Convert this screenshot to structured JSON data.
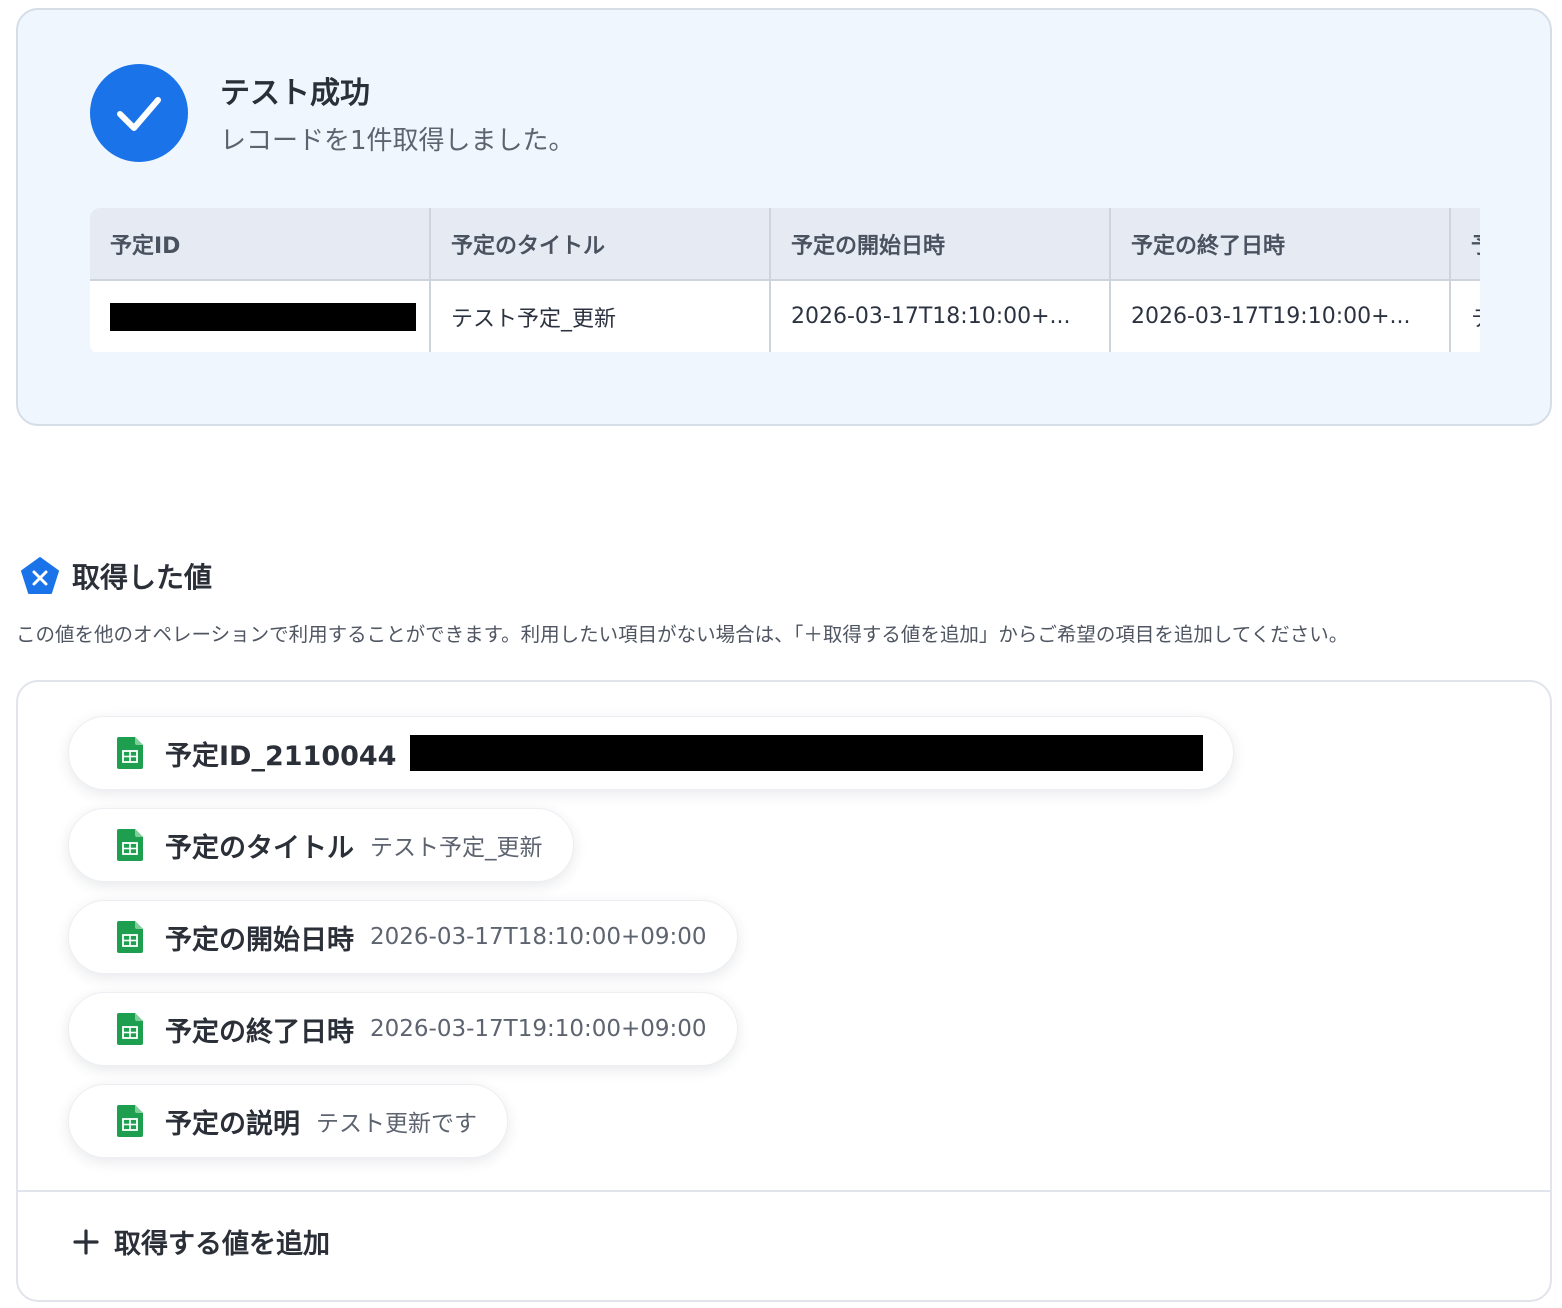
{
  "success": {
    "title": "テスト成功",
    "subtitle": "レコードを1件取得しました。"
  },
  "records_table": {
    "columns": [
      "予定ID",
      "予定のタイトル",
      "予定の開始日時",
      "予定の終了日時",
      "予"
    ],
    "rows": [
      {
        "title": "テスト予定_更新",
        "start": "2026-03-17T18:10:00+...",
        "end": "2026-03-17T19:10:00+...",
        "extra": "テ"
      }
    ]
  },
  "values_section": {
    "title": "取得した値",
    "description": "この値を他のオペレーションで利用することができます。利用したい項目がない場合は、「＋取得する値を追加」からご希望の項目を追加してください。",
    "items": [
      {
        "label": "予定ID_2110044",
        "value": ""
      },
      {
        "label": "予定のタイトル",
        "value": "テスト予定_更新"
      },
      {
        "label": "予定の開始日時",
        "value": "2026-03-17T18:10:00+09:00"
      },
      {
        "label": "予定の終了日時",
        "value": "2026-03-17T19:10:00+09:00"
      },
      {
        "label": "予定の説明",
        "value": "テスト更新です"
      }
    ],
    "add_label": "取得する値を追加"
  },
  "colors": {
    "accent": "#1a73e8",
    "sheet_green": "#1e9e4f",
    "panel_bg": "#eff6fe"
  },
  "icons": {
    "success": "check-circle-icon",
    "section": "pentagon-x-icon",
    "item": "spreadsheet-icon",
    "add": "plus-icon"
  }
}
